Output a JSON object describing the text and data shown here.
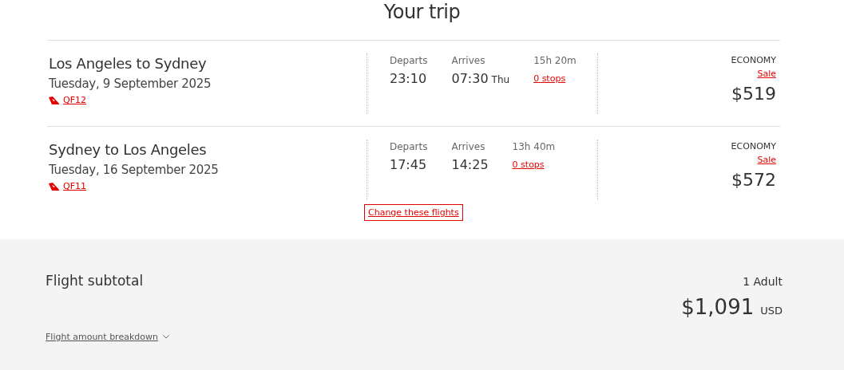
{
  "title": "Your trip",
  "flights": [
    {
      "route": "Los Angeles to Sydney",
      "date": "Tuesday, 9 September 2025",
      "flight_number": "QF12",
      "departs_label": "Departs",
      "departs": "23:10",
      "arrives_label": "Arrives",
      "arrives": "07:30",
      "arrives_day": "Thu",
      "duration": "15h 20m",
      "stops": "0 stops",
      "cabin": "ECONOMY",
      "fare": "Sale",
      "price": "$519"
    },
    {
      "route": "Sydney to Los Angeles",
      "date": "Tuesday, 16 September 2025",
      "flight_number": "QF11",
      "departs_label": "Departs",
      "departs": "17:45",
      "arrives_label": "Arrives",
      "arrives": "14:25",
      "duration": "13h 40m",
      "stops": "0 stops",
      "cabin": "ECONOMY",
      "fare": "Sale",
      "price": "$572"
    }
  ],
  "change_button": "Change these flights",
  "subtotal": {
    "label": "Flight subtotal",
    "passengers": "1 Adult",
    "amount": "$1,091",
    "currency": "USD",
    "breakdown_link": "Flight amount breakdown"
  }
}
